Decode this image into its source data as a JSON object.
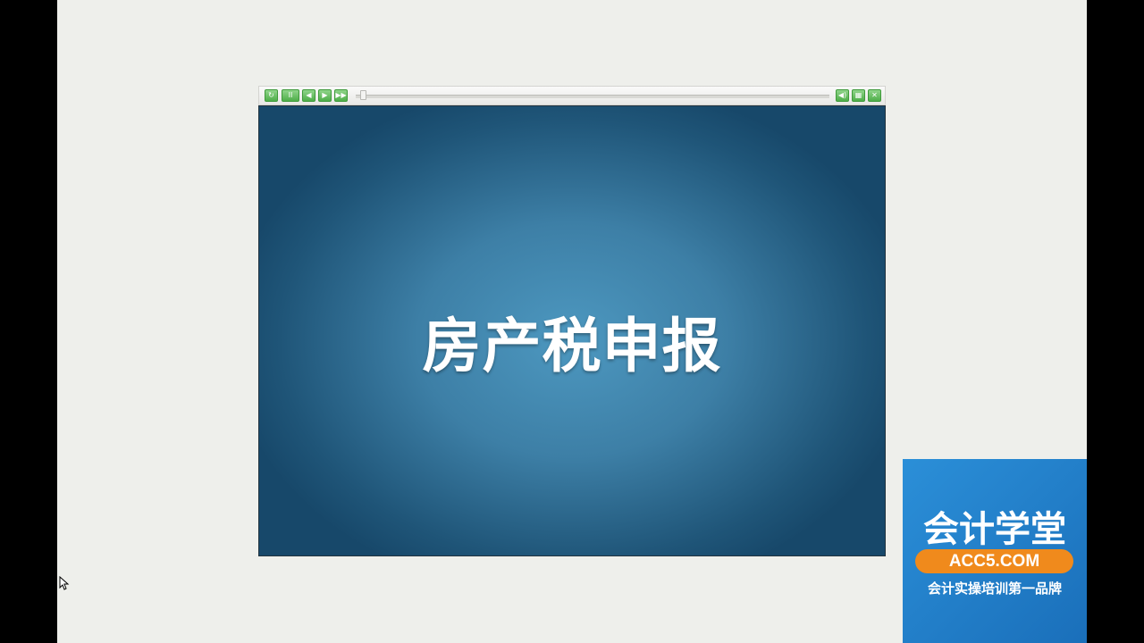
{
  "player": {
    "controls": {
      "replay_icon": "↻",
      "pause_icon": "II",
      "prev_icon": "◀",
      "next_icon": "▶",
      "forward_icon": "▶▶",
      "volume_icon": "◀)",
      "print_icon": "▦",
      "close_icon": "✕"
    },
    "progress_fraction": 0.01,
    "accent_color": "#4fae4a"
  },
  "slide": {
    "title": "房产税申报"
  },
  "brand": {
    "name": "会计学堂",
    "url": "ACC5.COM",
    "tagline": "会计实操培训第一品牌",
    "bg_color": "#1f7bc8",
    "url_color": "#f08a1c"
  }
}
